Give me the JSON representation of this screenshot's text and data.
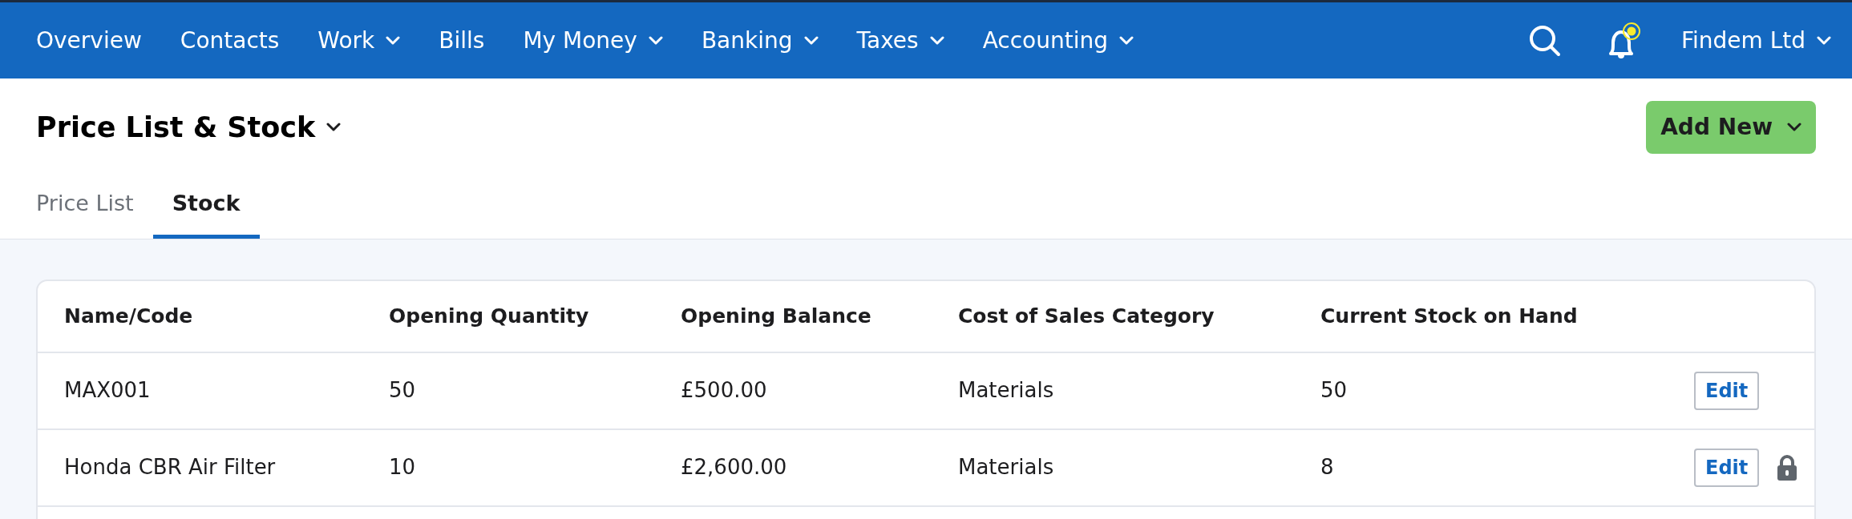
{
  "nav": {
    "items": [
      {
        "label": "Overview",
        "dropdown": false
      },
      {
        "label": "Contacts",
        "dropdown": false
      },
      {
        "label": "Work",
        "dropdown": true
      },
      {
        "label": "Bills",
        "dropdown": false
      },
      {
        "label": "My Money",
        "dropdown": true
      },
      {
        "label": "Banking",
        "dropdown": true
      },
      {
        "label": "Taxes",
        "dropdown": true
      },
      {
        "label": "Accounting",
        "dropdown": true
      }
    ],
    "notification_unread": true,
    "account": "Findem Ltd"
  },
  "page": {
    "title": "Price List & Stock",
    "add_button": "Add New"
  },
  "tabs": [
    {
      "label": "Price List",
      "selected": false
    },
    {
      "label": "Stock",
      "selected": true
    }
  ],
  "table": {
    "columns": [
      "Name/Code",
      "Opening Quantity",
      "Opening Balance",
      "Cost of Sales Category",
      "Current Stock on Hand"
    ],
    "rows": [
      {
        "cells": [
          "MAX001",
          "50",
          "£500.00",
          "Materials",
          "50"
        ],
        "action": "Edit",
        "locked": false
      },
      {
        "cells": [
          "Honda CBR Air Filter",
          "10",
          "£2,600.00",
          "Materials",
          "8"
        ],
        "action": "Edit",
        "locked": true
      }
    ]
  }
}
